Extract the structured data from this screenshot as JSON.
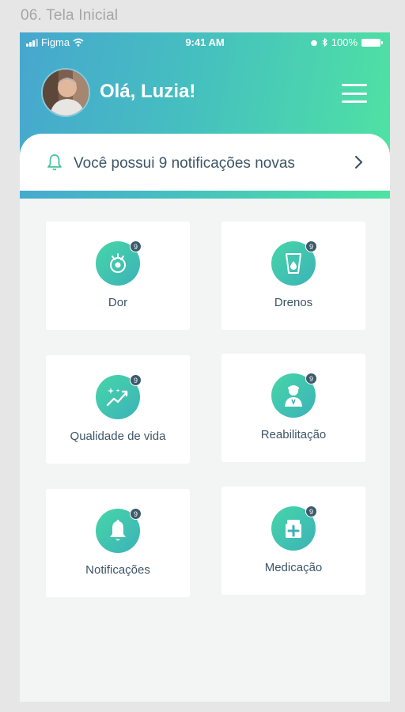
{
  "frame_label": "06. Tela Inicial",
  "status_bar": {
    "carrier": "Figma",
    "time": "9:41 AM",
    "battery": "100%"
  },
  "header": {
    "greeting": "Olá, Luzia!"
  },
  "notifications_banner": {
    "text": "Você possui 9 notificações novas"
  },
  "cards": [
    {
      "label": "Dor",
      "icon": "pain-icon",
      "badge": "9"
    },
    {
      "label": "Drenos",
      "icon": "drain-icon",
      "badge": "9"
    },
    {
      "label": "Qualidade de vida",
      "icon": "quality-of-life-icon",
      "badge": "9"
    },
    {
      "label": "Reabilitação",
      "icon": "rehabilitation-icon",
      "badge": "9"
    },
    {
      "label": "Notificações",
      "icon": "bell-icon",
      "badge": "9"
    },
    {
      "label": "Medicação",
      "icon": "medication-icon",
      "badge": "9"
    }
  ],
  "colors": {
    "header_gradient_start": "#47a7cf",
    "header_gradient_end": "#4fe3a2",
    "icon_gradient_start": "#46d6a8",
    "icon_gradient_end": "#3cb2b8",
    "text": "#3d5566",
    "badge": "#3c5a6c"
  }
}
